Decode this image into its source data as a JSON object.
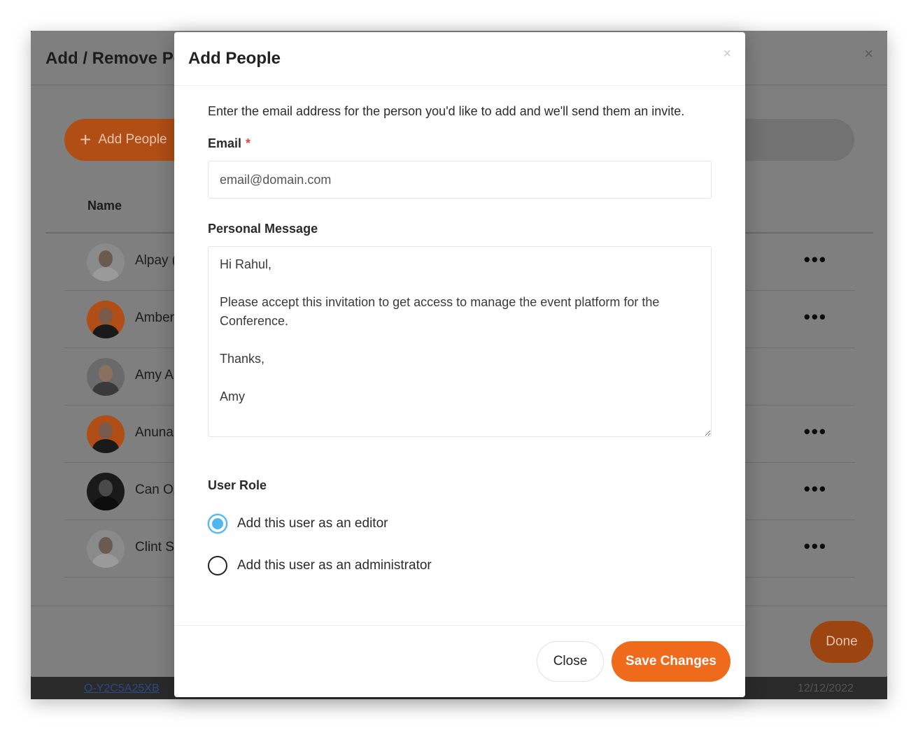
{
  "background_page": {
    "row_ref": "O-Y2C5A25XB",
    "row_date": "12/12/2022"
  },
  "background_modal": {
    "title": "Add / Remove Pe",
    "close_glyph": "×",
    "add_people_label": "Add People",
    "add_people_icon": "plus-icon",
    "column_name": "Name",
    "done_label": "Done",
    "more_glyph": "•••",
    "people": [
      {
        "name": "Alpay (",
        "avatar_bg": "#8a8a8a",
        "skin": "#6b5a50",
        "shirt": "#9a9a9a",
        "has_menu": true
      },
      {
        "name": "Amber",
        "avatar_bg": "#b04e15",
        "skin": "#7a5a4a",
        "shirt": "#1a1a1a",
        "has_menu": true
      },
      {
        "name": "Amy A",
        "avatar_bg": "#6a6a6a",
        "skin": "#8a7060",
        "shirt": "#3a3a3a",
        "has_menu": false
      },
      {
        "name": "Anuna",
        "avatar_bg": "#b04e15",
        "skin": "#7a5a4a",
        "shirt": "#1a1a1a",
        "has_menu": true
      },
      {
        "name": "Can Oz",
        "avatar_bg": "#1a1a1a",
        "skin": "#4a4a4a",
        "shirt": "#0d0d0d",
        "has_menu": true
      },
      {
        "name": "Clint S",
        "avatar_bg": "#8a8a8a",
        "skin": "#6b5a50",
        "shirt": "#9a9a9a",
        "has_menu": true
      }
    ]
  },
  "modal": {
    "title": "Add People",
    "close_glyph": "×",
    "intro": "Enter the email address for the person you'd like to add and we'll send them an invite.",
    "email_label": "Email",
    "required_mark": "*",
    "email_placeholder": "email@domain.com",
    "message_label": "Personal Message",
    "message_value": "Hi Rahul,\n\nPlease accept this invitation to get access to manage the event platform for the Conference.\n\nThanks,\n\nAmy",
    "role_label": "User Role",
    "role_options": [
      {
        "label": "Add this user as an editor",
        "selected": true
      },
      {
        "label": "Add this user as an administrator",
        "selected": false
      }
    ],
    "close_button": "Close",
    "save_button": "Save Changes"
  },
  "colors": {
    "accent": "#f06a1c",
    "radio_selected": "#4fb6ef",
    "required": "#e04848",
    "overlay": "#7f7f7f"
  }
}
